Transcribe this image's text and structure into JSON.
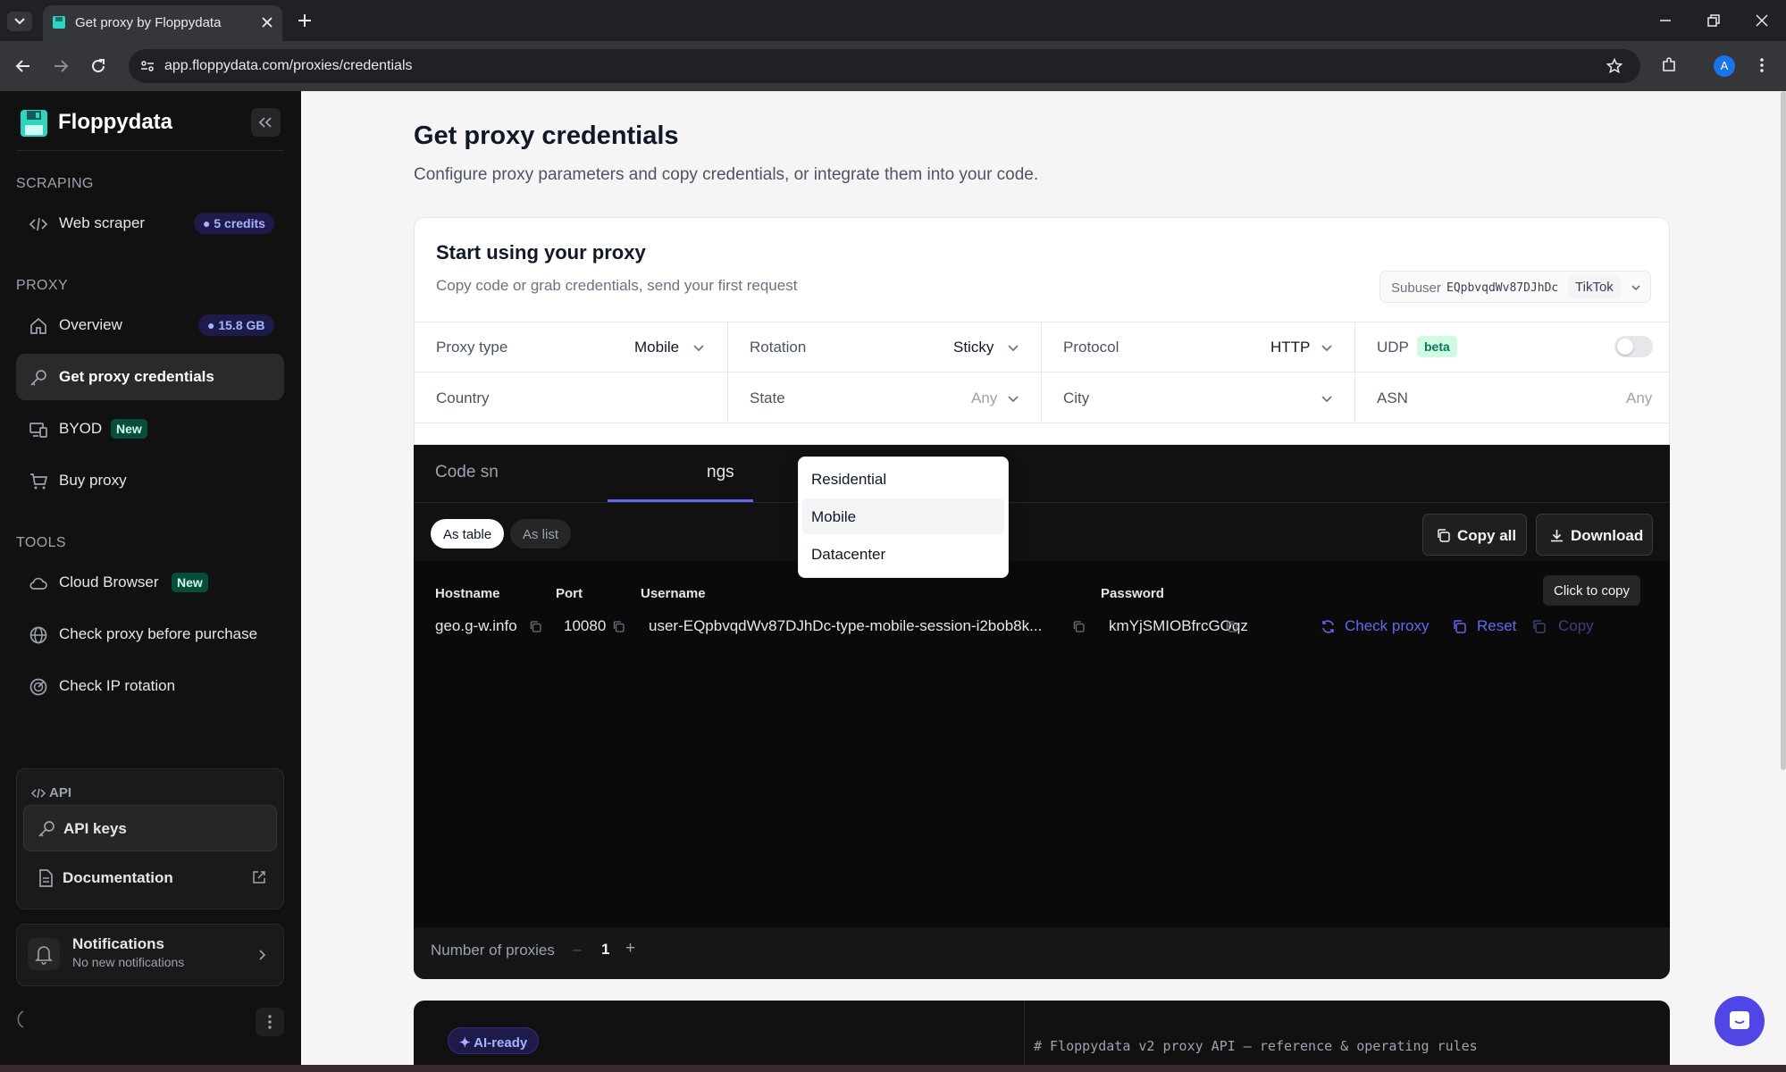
{
  "browser": {
    "tab_title": "Get proxy by Floppydata",
    "url": "app.floppydata.com/proxies/credentials",
    "profile_initial": "A"
  },
  "sidebar": {
    "brand": "Floppydata",
    "sections": {
      "scraping": "SCRAPING",
      "proxy": "PROXY",
      "tools": "TOOLS"
    },
    "items": {
      "web_scraper": {
        "label": "Web scraper",
        "badge": "5 credits"
      },
      "overview": {
        "label": "Overview",
        "badge": "15.8 GB"
      },
      "get_proxy_credentials": {
        "label": "Get proxy credentials"
      },
      "byod": {
        "label": "BYOD",
        "badge": "New"
      },
      "buy_proxy": {
        "label": "Buy proxy"
      },
      "cloud_browser": {
        "label": "Cloud Browser",
        "badge": "New"
      },
      "check_proxy": {
        "label": "Check proxy before purchase"
      },
      "check_ip_rotation": {
        "label": "Check IP rotation"
      }
    },
    "api": {
      "label": "API",
      "api_keys": "API keys",
      "documentation": "Documentation"
    },
    "notifications": {
      "title": "Notifications",
      "subtitle": "No new notifications"
    }
  },
  "main": {
    "title": "Get proxy credentials",
    "subtitle": "Configure proxy parameters and copy credentials, or integrate them into your code.",
    "card": {
      "title": "Start using your proxy",
      "subtitle": "Copy code or grab credentials, send your first request",
      "subuser_label": "Subuser",
      "subuser_id": "EQpbvqdWv87DJhDc",
      "subuser_tag": "TikTok"
    },
    "fields": {
      "proxy_type": {
        "label": "Proxy type",
        "value": "Mobile"
      },
      "rotation": {
        "label": "Rotation",
        "value": "Sticky"
      },
      "protocol": {
        "label": "Protocol",
        "value": "HTTP"
      },
      "udp": {
        "label": "UDP",
        "badge": "beta",
        "enabled": false
      },
      "country": {
        "label": "Country"
      },
      "state": {
        "label": "State",
        "value": "Any"
      },
      "city": {
        "label": "City"
      },
      "asn": {
        "label": "ASN",
        "value": "Any"
      }
    },
    "proxy_type_options": [
      "Residential",
      "Mobile",
      "Datacenter"
    ],
    "tabs": {
      "code": "Code sn",
      "settings": "ngs"
    },
    "view_toggle": {
      "table": "As table",
      "list": "As list"
    },
    "buttons": {
      "copy_all": "Copy all",
      "download": "Download"
    },
    "table": {
      "headers": {
        "hostname": "Hostname",
        "port": "Port",
        "username": "Username",
        "password": "Password"
      },
      "row": {
        "hostname": "geo.g-w.info",
        "port": "10080",
        "username": "user-EQpbvqdWv87DJhDc-type-mobile-session-i2bob8k...",
        "password": "kmYjSMIOBfrcGOqz"
      },
      "actions": {
        "check": "Check proxy",
        "reset": "Reset",
        "copy": "Copy"
      },
      "tooltip": "Click to copy"
    },
    "proxies_count": {
      "label": "Number of proxies",
      "value": "1",
      "minus": "–",
      "plus": "+"
    },
    "bottom": {
      "badge": "✦ AI-ready",
      "code_comment": "# Floppydata v2 proxy API — reference & operating rules"
    }
  },
  "colors": {
    "accent": "#6366f1",
    "sidebar_bg": "#111111",
    "new_badge": "#064e3b"
  }
}
